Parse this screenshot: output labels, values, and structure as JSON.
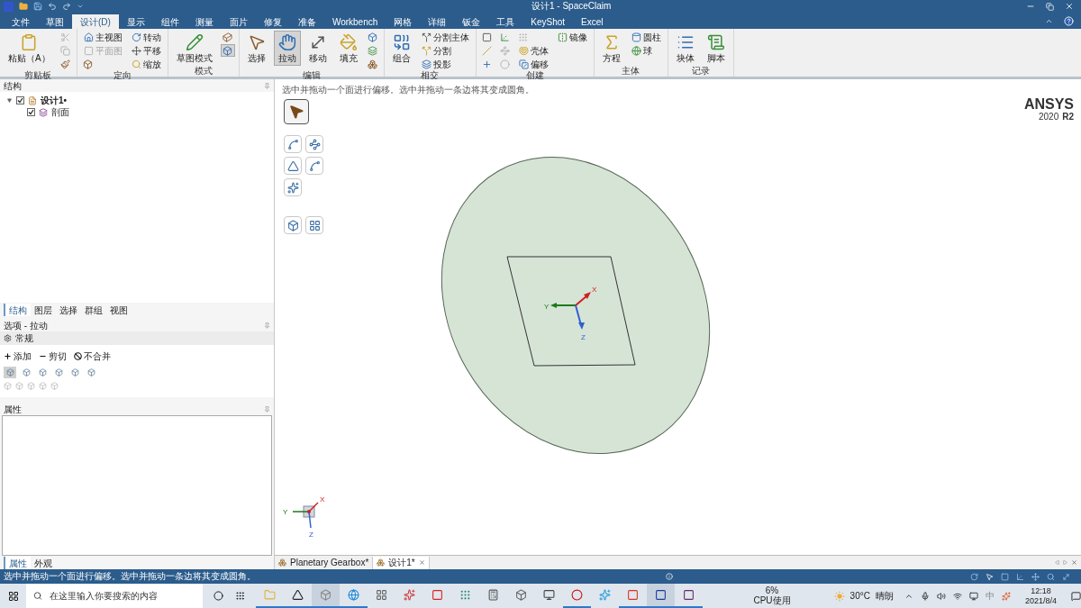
{
  "window": {
    "title": "设计1 - SpaceClaim"
  },
  "menu_tabs": [
    {
      "label": "文件",
      "selected": false
    },
    {
      "label": "草图",
      "selected": false
    },
    {
      "label": "设计(D)",
      "selected": true
    },
    {
      "label": "显示",
      "selected": false
    },
    {
      "label": "组件",
      "selected": false
    },
    {
      "label": "测量",
      "selected": false
    },
    {
      "label": "面片",
      "selected": false
    },
    {
      "label": "修复",
      "selected": false
    },
    {
      "label": "准备",
      "selected": false
    },
    {
      "label": "Workbench",
      "selected": false
    },
    {
      "label": "网格",
      "selected": false
    },
    {
      "label": "详细",
      "selected": false
    },
    {
      "label": "钣金",
      "selected": false
    },
    {
      "label": "工具",
      "selected": false
    },
    {
      "label": "KeyShot",
      "selected": false
    },
    {
      "label": "Excel",
      "selected": false
    }
  ],
  "ribbon_groups": [
    {
      "label": "剪贴板",
      "tools": [
        {
          "kind": "large",
          "label": "粘贴（A）",
          "selected": false,
          "disabled": false
        },
        {
          "kind": "icon",
          "selected": false,
          "disabled": true
        },
        {
          "kind": "icon",
          "selected": false,
          "disabled": true
        },
        {
          "kind": "icon",
          "selected": false,
          "disabled": false
        }
      ]
    },
    {
      "label": "定向",
      "tools": [
        {
          "kind": "row",
          "label": "主视图",
          "selected": false,
          "disabled": false
        },
        {
          "kind": "row",
          "label": "平面图",
          "selected": false,
          "disabled": true
        },
        {
          "kind": "icon",
          "selected": false,
          "disabled": false
        },
        {
          "kind": "row",
          "label": "转动",
          "selected": false,
          "disabled": false
        },
        {
          "kind": "row",
          "label": "平移",
          "selected": false,
          "disabled": false
        },
        {
          "kind": "row",
          "label": "缩放",
          "selected": false,
          "disabled": false
        }
      ]
    },
    {
      "label": "模式",
      "tools": [
        {
          "kind": "large",
          "label": "草图模式",
          "selected": false,
          "disabled": false
        },
        {
          "kind": "icon",
          "selected": false,
          "disabled": false
        },
        {
          "kind": "icon",
          "selected": true,
          "disabled": false
        }
      ]
    },
    {
      "label": "编辑",
      "tools": [
        {
          "kind": "large",
          "label": "选择",
          "selected": false,
          "disabled": false
        },
        {
          "kind": "large",
          "label": "拉动",
          "selected": true,
          "disabled": false
        },
        {
          "kind": "large",
          "label": "移动",
          "selected": false,
          "disabled": false
        },
        {
          "kind": "large",
          "label": "填充",
          "selected": false,
          "disabled": false
        },
        {
          "kind": "icon",
          "selected": false,
          "disabled": false
        },
        {
          "kind": "icon",
          "selected": false,
          "disabled": false
        },
        {
          "kind": "icon",
          "selected": false,
          "disabled": false
        }
      ]
    },
    {
      "label": "相交",
      "tools": [
        {
          "kind": "large",
          "label": "组合",
          "selected": false,
          "disabled": false
        },
        {
          "kind": "row",
          "label": "分割主体",
          "selected": false,
          "disabled": false
        },
        {
          "kind": "row",
          "label": "分割",
          "selected": false,
          "disabled": false
        },
        {
          "kind": "row",
          "label": "投影",
          "selected": false,
          "disabled": false
        }
      ]
    },
    {
      "label": "创建",
      "tools": [
        {
          "kind": "icon",
          "selected": false,
          "disabled": false
        },
        {
          "kind": "icon",
          "selected": false,
          "disabled": false
        },
        {
          "kind": "icon",
          "selected": false,
          "disabled": false
        },
        {
          "kind": "icon",
          "selected": false,
          "disabled": false
        },
        {
          "kind": "icon",
          "selected": false,
          "disabled": true
        },
        {
          "kind": "icon",
          "selected": false,
          "disabled": true
        },
        {
          "kind": "icon",
          "selected": false,
          "disabled": true
        },
        {
          "kind": "row",
          "label": "壳体",
          "selected": false,
          "disabled": false
        },
        {
          "kind": "row",
          "label": "偏移",
          "selected": false,
          "disabled": false
        },
        {
          "kind": "row",
          "label": "镜像",
          "selected": false,
          "disabled": false
        }
      ]
    },
    {
      "label": "主体",
      "tools": [
        {
          "kind": "large",
          "label": "方程",
          "selected": false,
          "disabled": false
        },
        {
          "kind": "row",
          "label": "圆柱",
          "selected": false,
          "disabled": false
        },
        {
          "kind": "row",
          "label": "球",
          "selected": false,
          "disabled": false
        }
      ]
    },
    {
      "label": "记录",
      "tools": [
        {
          "kind": "large",
          "label": "块体",
          "selected": false,
          "disabled": false
        },
        {
          "kind": "large",
          "label": "脚本",
          "selected": false,
          "disabled": false
        }
      ]
    }
  ],
  "structure_panel": {
    "title": "结构",
    "tree": [
      {
        "label": "设计1•",
        "checked": true,
        "expanded": true,
        "children": [
          {
            "label": "剖面",
            "checked": true
          }
        ]
      }
    ]
  },
  "panel_tabs": [
    {
      "label": "结构",
      "selected": true
    },
    {
      "label": "图层",
      "selected": false
    },
    {
      "label": "选择",
      "selected": false
    },
    {
      "label": "群组",
      "selected": false
    },
    {
      "label": "视图",
      "selected": false
    }
  ],
  "options_panel": {
    "title": "选项 - 拉动",
    "section": "常规",
    "options": [
      "添加",
      "剪切",
      "不合并"
    ],
    "tools": [
      {
        "selected": true
      },
      {
        "selected": false
      },
      {
        "selected": false
      },
      {
        "selected": false
      },
      {
        "selected": false
      },
      {
        "selected": false
      }
    ]
  },
  "properties_panel": {
    "title": "属性"
  },
  "bottom_tabs": [
    {
      "label": "属性",
      "selected": true
    },
    {
      "label": "外观",
      "selected": false
    }
  ],
  "viewport": {
    "hint": "选中并拖动一个面进行偏移。选中并拖动一条边将其变成圆角。",
    "logo": {
      "brand": "ANSYS",
      "version": "2020",
      "release": "R2"
    },
    "tools": [
      {
        "selected": true
      },
      {
        "selected": false
      },
      {
        "selected": false
      },
      {
        "selected": false
      },
      {
        "selected": false
      },
      {
        "selected": false
      },
      {
        "selected": false
      },
      {
        "selected": false
      }
    ],
    "triad": {
      "x": "X",
      "y": "Y",
      "z": "Z"
    },
    "mini_triad": {
      "x": "X",
      "y": "Y",
      "z": "Z"
    }
  },
  "doc_tabs": [
    {
      "label": "Planetary Gearbox*",
      "selected": false
    },
    {
      "label": "设计1*",
      "selected": true
    }
  ],
  "status_bar": {
    "message": "选中并拖动一个面进行偏移。选中并拖动一条边将其变成圆角。"
  },
  "taskbar": {
    "search_placeholder": "在这里输入你要搜索的内容",
    "apps": [
      {
        "running": true,
        "active": false
      },
      {
        "running": true,
        "active": false
      },
      {
        "running": true,
        "active": true
      },
      {
        "running": true,
        "active": false
      },
      {
        "running": false,
        "active": false
      },
      {
        "running": false,
        "active": false
      },
      {
        "running": false,
        "active": false
      },
      {
        "running": false,
        "active": false
      },
      {
        "running": false,
        "active": false
      },
      {
        "running": false,
        "active": false
      },
      {
        "running": false,
        "active": false
      },
      {
        "running": true,
        "active": false
      },
      {
        "running": false,
        "active": false
      },
      {
        "running": true,
        "active": false
      },
      {
        "running": true,
        "active": true
      },
      {
        "running": true,
        "active": false
      }
    ],
    "cpu_value": "6%",
    "cpu_label": "CPU使用",
    "temperature": "30°C",
    "weather": "晴朗",
    "ime": "中",
    "time": "12:18",
    "date": "2021/8/4"
  }
}
